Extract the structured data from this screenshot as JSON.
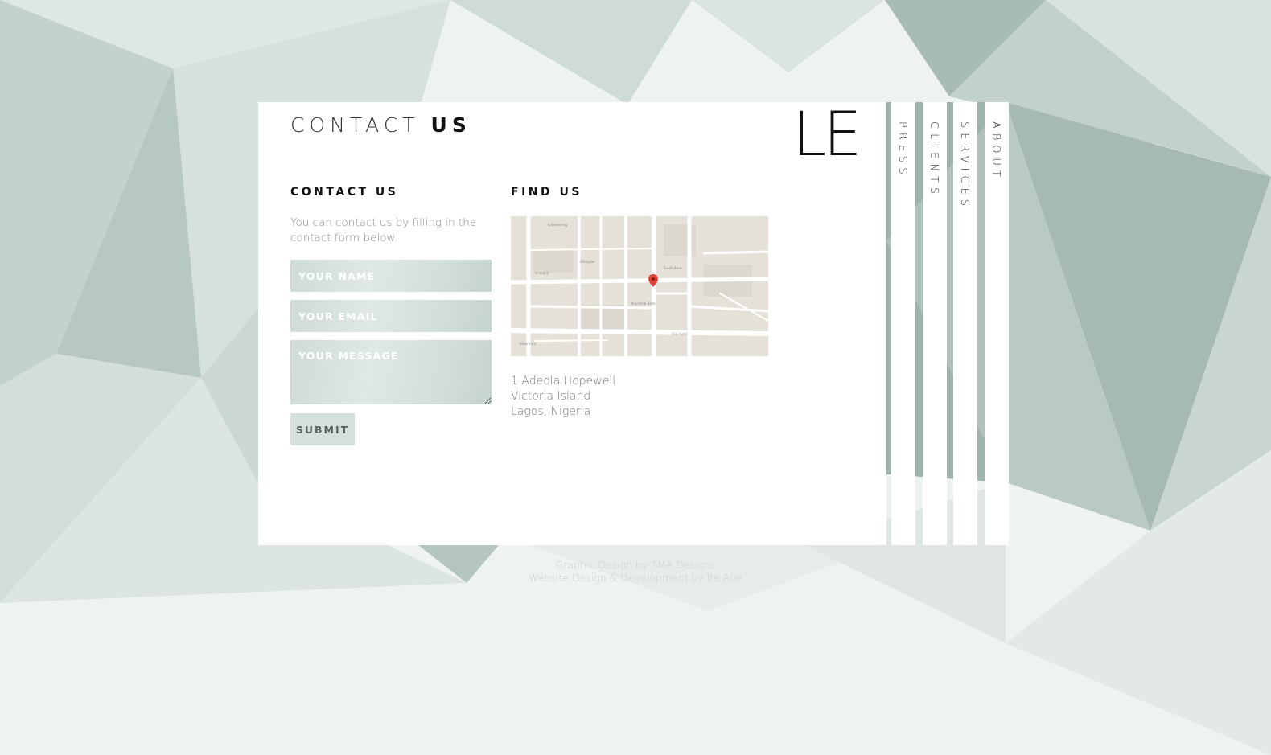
{
  "page": {
    "heading_light": "CONTACT",
    "heading_bold": "US",
    "logo": "LE"
  },
  "contact": {
    "title": "CONTACT US",
    "intro": "You can contact us by filling in the contact form below.",
    "name_placeholder": "YOUR NAME",
    "email_placeholder": "YOUR EMAIL",
    "message_placeholder": "YOUR MESSAGE",
    "submit_label": "SUBMIT"
  },
  "find": {
    "title": "FIND US",
    "address": [
      "1 Adeola Hopewell",
      "Victoria Island",
      "Lagos, Nigeria"
    ]
  },
  "nav": {
    "items": [
      "PRESS",
      "CLIENTS",
      "SERVICES",
      "ABOUT"
    ]
  },
  "footer": {
    "line1": "Graphic Design by TMA Designs",
    "line2": "Website Design & Development by Ire Ade"
  }
}
